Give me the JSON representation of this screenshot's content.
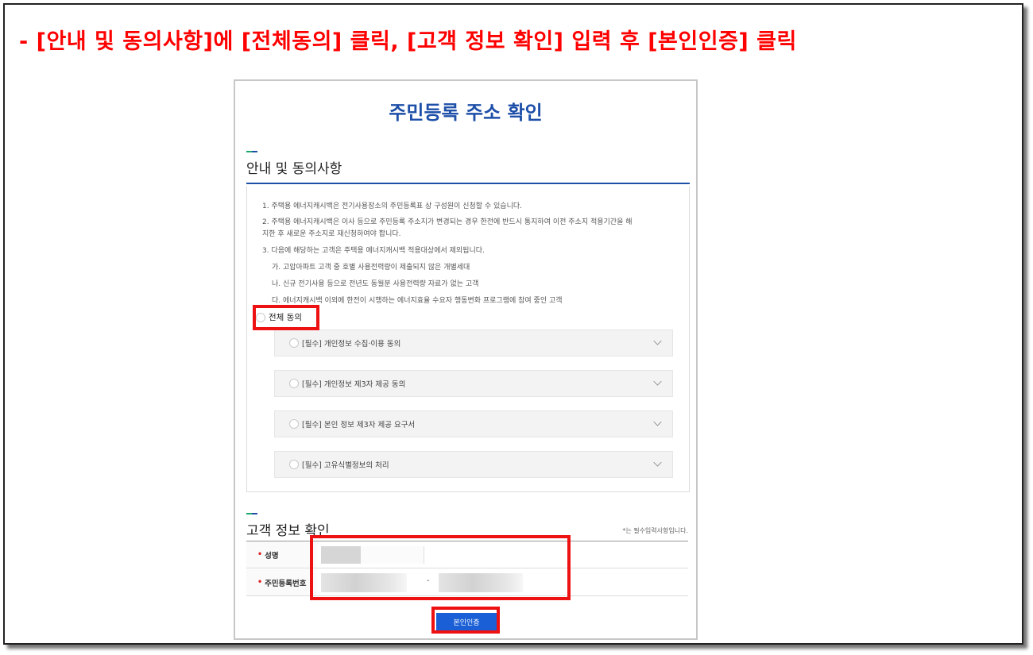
{
  "instruction": "- [안내 및 동의사항]에 [전체동의] 클릭, [고객 정보 확인] 입력 후 [본인인증] 클릭",
  "page_title": "주민등록 주소 확인",
  "notice_section": {
    "title": "안내 및 동의사항",
    "lines": [
      "1. 주택용 에너지캐시백은 전기사용장소의 주민등록표 상 구성원이 신청할 수 있습니다.",
      "2. 주택용 에너지캐시백은 이사 등으로 주민등록 주소지가 변경되는 경우 한전에 반드시 통지하여 이전 주소지 적용기간을 해",
      "지한 후 새로운 주소지로 재신청하여야 합니다.",
      "3. 다음에 해당하는 고객은 주택용 에너지캐시백 적용대상에서 제외됩니다.",
      "가. 고압아파트 고객 중 호별 사용전력량이 제출되지 않은 개별세대",
      "나. 신규 전기사용 등으로 전년도 동월분 사용전력량 자료가 없는 고객",
      "다. 에너지캐시백 이외에 한전이 시행하는 에너지효율 수요자 행동변화 프로그램에 참여 중인 고객"
    ],
    "all_agree_label": "전체 동의",
    "items": [
      {
        "label": "[필수] 개인정보 수집·이용 동의"
      },
      {
        "label": "[필수] 개인정보 제3자 제공 동의"
      },
      {
        "label": "[필수] 본인 정보 제3자 제공 요구서"
      },
      {
        "label": "[필수] 고유식별정보의 처리"
      }
    ]
  },
  "customer_section": {
    "title": "고객 정보 확인",
    "required_note": "*는 필수입력사항입니다.",
    "name_label": "성명",
    "rrn_label": "주민등록번호",
    "rrn_separator": "-",
    "submit_label": "본인인증"
  },
  "colors": {
    "instruction_red": "#ff0000",
    "title_blue": "#1d4fa8",
    "button_blue": "#1a5fd6",
    "highlight_red": "#ee1111"
  }
}
